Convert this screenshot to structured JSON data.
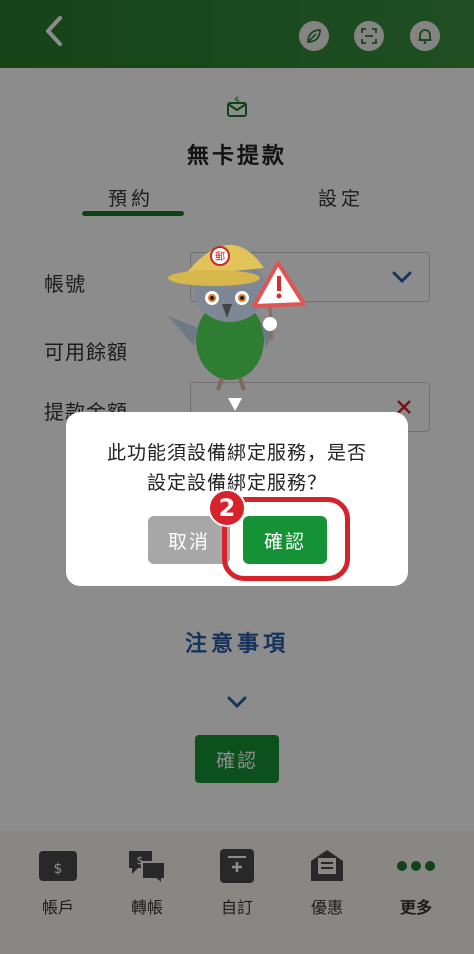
{
  "header": {
    "back_icon": "chevron-left-icon",
    "actions": [
      "leaf-icon",
      "scan-icon",
      "bell-icon"
    ]
  },
  "card": {
    "title": "無卡提款",
    "tabs": [
      {
        "label": "預約",
        "active": true
      },
      {
        "label": "設定",
        "active": false
      }
    ]
  },
  "form": {
    "account_label": "帳號",
    "balance_label": "可用餘額",
    "amount_label": "提款金額"
  },
  "notes": {
    "title": "注意事項"
  },
  "page_confirm_label": "確認",
  "dialog": {
    "line1": "此功能須設備綁定服務，是否",
    "line2": "設定設備綁定服務？",
    "cancel_label": "取消",
    "confirm_label": "確認",
    "step_number": "2"
  },
  "tabbar": [
    {
      "label": "帳戶",
      "icon": "wallet-icon"
    },
    {
      "label": "轉帳",
      "icon": "transfer-icon"
    },
    {
      "label": "自訂",
      "icon": "custom-icon"
    },
    {
      "label": "優惠",
      "icon": "offer-icon"
    },
    {
      "label": "更多",
      "icon": "more-dots-icon"
    }
  ],
  "colors": {
    "brand_green": "#169236",
    "header_green": "#2f8234",
    "highlight_red": "#d6232b",
    "notes_blue": "#2a5da8"
  }
}
